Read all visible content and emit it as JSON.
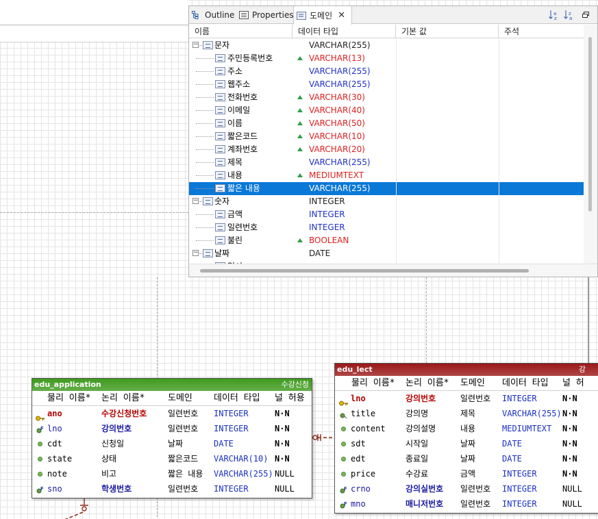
{
  "view": {
    "tabs": [
      {
        "label": "Outline",
        "icon": "outline-icon"
      },
      {
        "label": "Properties",
        "icon": "properties-icon"
      },
      {
        "label": "도메인",
        "icon": "domain-icon",
        "active": true
      }
    ],
    "toolbar": {
      "sort_asc": "↓a z",
      "sort_desc": "↓z a",
      "restore": "▭"
    },
    "columns": [
      "이름",
      "데이터 타입",
      "기본 값",
      "주석"
    ],
    "rows": [
      {
        "level": 0,
        "name": "문자",
        "type": "VARCHAR(255)",
        "style": "black",
        "changed": false
      },
      {
        "level": 1,
        "name": "주민등록번호",
        "type": "VARCHAR(13)",
        "style": "red",
        "changed": true
      },
      {
        "level": 1,
        "name": "주소",
        "type": "VARCHAR(255)",
        "style": "blue",
        "changed": false
      },
      {
        "level": 1,
        "name": "웹주소",
        "type": "VARCHAR(255)",
        "style": "blue",
        "changed": false
      },
      {
        "level": 1,
        "name": "전화번호",
        "type": "VARCHAR(30)",
        "style": "red",
        "changed": true
      },
      {
        "level": 1,
        "name": "이메일",
        "type": "VARCHAR(40)",
        "style": "red",
        "changed": true
      },
      {
        "level": 1,
        "name": "이름",
        "type": "VARCHAR(50)",
        "style": "red",
        "changed": true
      },
      {
        "level": 1,
        "name": "짧은코드",
        "type": "VARCHAR(10)",
        "style": "red",
        "changed": true
      },
      {
        "level": 1,
        "name": "계좌번호",
        "type": "VARCHAR(20)",
        "style": "red",
        "changed": true
      },
      {
        "level": 1,
        "name": "제목",
        "type": "VARCHAR(255)",
        "style": "blue",
        "changed": false
      },
      {
        "level": 1,
        "name": "내용",
        "type": "MEDIUMTEXT",
        "style": "red",
        "changed": true
      },
      {
        "level": 1,
        "name": "짧은 내용",
        "type": "VARCHAR(255)",
        "style": "blue",
        "changed": false,
        "selected": true
      },
      {
        "level": 0,
        "name": "숫자",
        "type": "INTEGER",
        "style": "black",
        "changed": false
      },
      {
        "level": 1,
        "name": "금액",
        "type": "INTEGER",
        "style": "blue",
        "changed": false
      },
      {
        "level": 1,
        "name": "일련번호",
        "type": "INTEGER",
        "style": "blue",
        "changed": false
      },
      {
        "level": 1,
        "name": "불린",
        "type": "BOOLEAN",
        "style": "red",
        "changed": true
      },
      {
        "level": 0,
        "name": "날짜",
        "type": "DATE",
        "style": "black",
        "changed": false
      },
      {
        "level": 1,
        "name": "일시",
        "type": "",
        "style": "black",
        "changed": false
      }
    ]
  },
  "tables": {
    "application": {
      "name": "edu_application",
      "alias": "수강신청",
      "title_color": "#3f9a1e",
      "headers": [
        "물리 이름*",
        "논리 이름*",
        "도메인",
        "데이터 타입",
        "널 허용"
      ],
      "rows": [
        {
          "kind": "pk",
          "phys": "ano",
          "logical": "수강신청번호",
          "domain": "일련번호",
          "type": "INTEGER",
          "null": "N·N"
        },
        {
          "kind": "fk",
          "phys": "lno",
          "logical": "강의번호",
          "domain": "일련번호",
          "type": "INTEGER",
          "null": "N·N"
        },
        {
          "kind": "col",
          "phys": "cdt",
          "logical": "신청일",
          "domain": "날짜",
          "type": "DATE",
          "null": "N·N"
        },
        {
          "kind": "col",
          "phys": "state",
          "logical": "상태",
          "domain": "짧은코드",
          "type": "VARCHAR(10)",
          "null": "N·N"
        },
        {
          "kind": "col",
          "phys": "note",
          "logical": "비고",
          "domain": "짧은 내용",
          "type": "VARCHAR(255)",
          "null": "NULL"
        },
        {
          "kind": "fk",
          "phys": "sno",
          "logical": "학생번호",
          "domain": "일련번호",
          "type": "INTEGER",
          "null": "NULL"
        }
      ]
    },
    "lect": {
      "name": "edu_lect",
      "alias": "강",
      "title_color": "#9a1818",
      "headers": [
        "물리 이름*",
        "논리 이름*",
        "도메인",
        "데이터 타입",
        "널 허"
      ],
      "rows": [
        {
          "kind": "pk",
          "phys": "lno",
          "logical": "강의번호",
          "domain": "일련번호",
          "type": "INTEGER",
          "null": "N·N"
        },
        {
          "kind": "idx",
          "phys": "title",
          "logical": "강의명",
          "domain": "제목",
          "type": "VARCHAR(255)",
          "null": "N·N"
        },
        {
          "kind": "col",
          "phys": "content",
          "logical": "강의설명",
          "domain": "내용",
          "type": "MEDIUMTEXT",
          "null": "N·N"
        },
        {
          "kind": "col",
          "phys": "sdt",
          "logical": "시작일",
          "domain": "날짜",
          "type": "DATE",
          "null": "N·N"
        },
        {
          "kind": "col",
          "phys": "edt",
          "logical": "종료일",
          "domain": "날짜",
          "type": "DATE",
          "null": "N·N"
        },
        {
          "kind": "col",
          "phys": "price",
          "logical": "수강료",
          "domain": "금액",
          "type": "INTEGER",
          "null": "N·N"
        },
        {
          "kind": "fk",
          "phys": "crno",
          "logical": "강의실번호",
          "domain": "일련번호",
          "type": "INTEGER",
          "null": "NULL"
        },
        {
          "kind": "fk",
          "phys": "mno",
          "logical": "매니저번호",
          "domain": "일련번호",
          "type": "INTEGER",
          "null": "NULL"
        }
      ]
    }
  },
  "colors": {
    "selection": "#0a78d7",
    "red_text": "#e02020",
    "blue_text": "#2030c8",
    "changed_marker": "#2ea043",
    "relation": "#8b2a1a"
  }
}
